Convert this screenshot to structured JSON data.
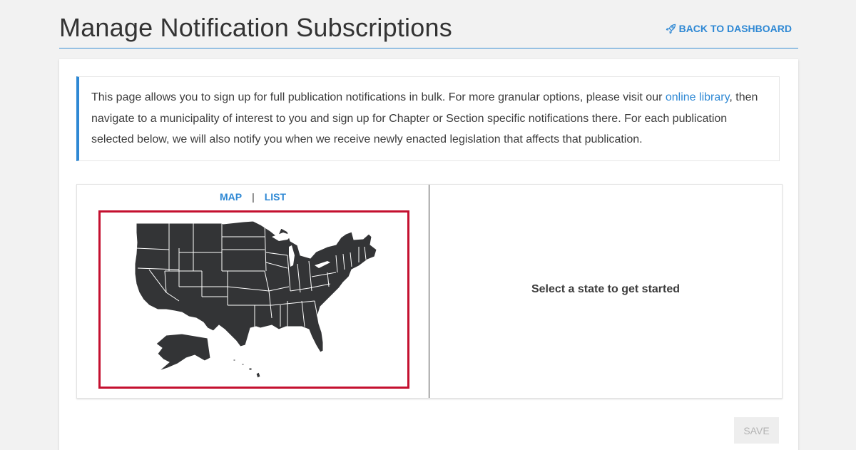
{
  "header": {
    "title": "Manage Notification Subscriptions",
    "back_link_label": "BACK TO DASHBOARD"
  },
  "info": {
    "text_before_link": "This page allows you to sign up for full publication notifications in bulk. For more granular options, please visit our ",
    "link_label": "online library",
    "text_after_link": ", then navigate to a municipality of interest to you and sign up for Chapter or Section specific notifications there. For each publication selected below, we will also notify you when we receive newly enacted legislation that affects that publication."
  },
  "view_toggle": {
    "map_label": "MAP",
    "separator": "|",
    "list_label": "LIST"
  },
  "map": {
    "fill_color": "#333436",
    "border_color": "#c4102f"
  },
  "right_pane": {
    "prompt": "Select a state to get started"
  },
  "footer": {
    "save_label": "SAVE"
  },
  "colors": {
    "accent": "#2e88d4",
    "title_rule": "#3a8fd3"
  }
}
